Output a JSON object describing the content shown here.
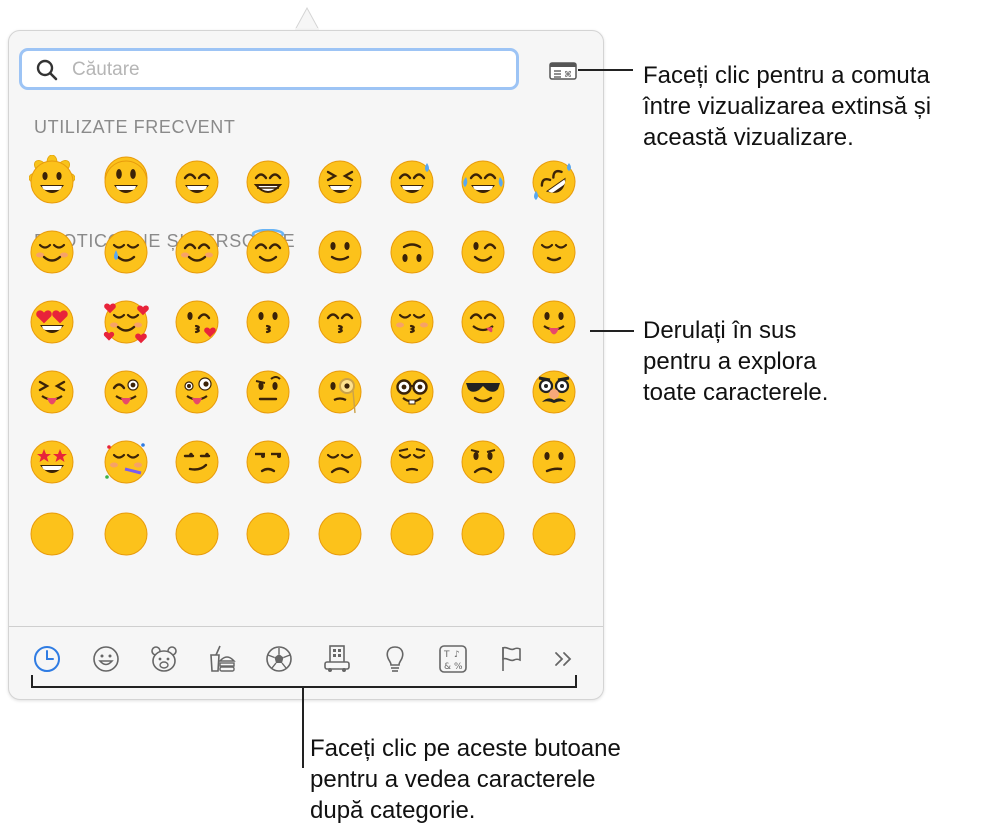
{
  "popover": {
    "search": {
      "placeholder": "Căutare",
      "value": ""
    },
    "sections": [
      {
        "title": "UTILIZATE FRECVENT"
      },
      {
        "title": "EMOTICOANE ȘI PERSOANE"
      }
    ],
    "frequent": [
      "sunflower",
      "tired-face"
    ],
    "emoji_rows": [
      [
        "grinning",
        "smiley",
        "smile",
        "grin",
        "laughing",
        "sweat-smile",
        "joy",
        "rofl"
      ],
      [
        "relaxed",
        "smiling-tear",
        "blush",
        "innocent",
        "slight-smile",
        "upside-down",
        "wink",
        "relieved"
      ],
      [
        "heart-eyes",
        "smiling-hearts",
        "kissing-heart",
        "kissing",
        "kissing-smiling-eyes",
        "kissing-closed-eyes",
        "yum",
        "tongue-out"
      ],
      [
        "squinting-tongue",
        "winking-tongue",
        "zany",
        "raised-eyebrow",
        "monocle",
        "nerd",
        "sunglasses",
        "disguised"
      ],
      [
        "star-struck",
        "partying",
        "smirk",
        "unamused",
        "disappointed",
        "pensive",
        "worried",
        "confused"
      ]
    ],
    "tabs": [
      {
        "icon": "clock-icon",
        "label": "Frecvent"
      },
      {
        "icon": "smiley-icon",
        "label": "Emoticoane"
      },
      {
        "icon": "bear-icon",
        "label": "Animale"
      },
      {
        "icon": "food-icon",
        "label": "Mâncare"
      },
      {
        "icon": "soccer-ball-icon",
        "label": "Activități"
      },
      {
        "icon": "buildings-icon",
        "label": "Călătorii"
      },
      {
        "icon": "lightbulb-icon",
        "label": "Obiecte"
      },
      {
        "icon": "symbols-icon",
        "label": "Simboluri"
      },
      {
        "icon": "flag-icon",
        "label": "Steaguri"
      },
      {
        "icon": "more-icon",
        "label": "Mai multe"
      }
    ],
    "accent": "#2f7ce3"
  },
  "callouts": {
    "toggle_view": [
      "Faceți clic pentru a comuta",
      "între vizualizarea extinsă și",
      "această vizualizare."
    ],
    "scroll": [
      "Derulați în sus",
      "pentru a explora",
      "toate caracterele."
    ],
    "categories": [
      "Faceți clic pe aceste butoane",
      "pentru a vedea caracterele",
      "după categorie."
    ]
  }
}
